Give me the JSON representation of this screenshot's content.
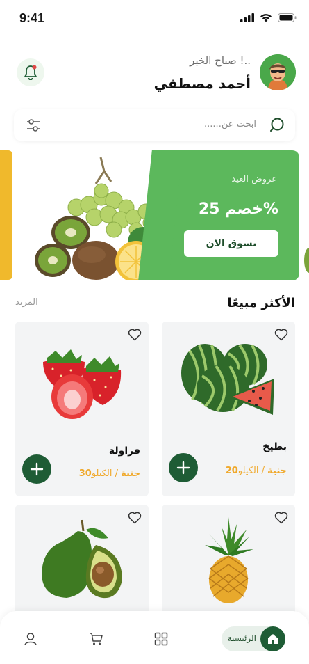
{
  "status_bar": {
    "time": "9:41"
  },
  "header": {
    "greeting": "صباح الخير !..",
    "user_name": "أحمد مصطفي"
  },
  "search": {
    "placeholder": "ابحث عن......"
  },
  "banner": {
    "label": "عروض العيد",
    "discount": "خصم 25%",
    "cta": "تسوق الان"
  },
  "section": {
    "title": "الأكثر مبيعًا",
    "more": "المزيد"
  },
  "products": [
    {
      "name": "بطيخ",
      "price": "20جنية",
      "unit": " / الكيلو"
    },
    {
      "name": "فراولة",
      "price": "30جنية",
      "unit": " / الكيلو"
    },
    {
      "name": "",
      "price": "",
      "unit": ""
    },
    {
      "name": "",
      "price": "",
      "unit": ""
    }
  ],
  "bottom_nav": {
    "home_label": "الرئيسية"
  },
  "colors": {
    "primary": "#1e5c35",
    "banner_green": "#5cb85c",
    "accent": "#f0a92c"
  },
  "icons": [
    "signal-icon",
    "wifi-icon",
    "battery-icon",
    "bell-icon",
    "search-icon",
    "filter-icon",
    "heart-icon",
    "plus-icon",
    "home-icon",
    "grid-icon",
    "cart-icon",
    "user-icon"
  ]
}
